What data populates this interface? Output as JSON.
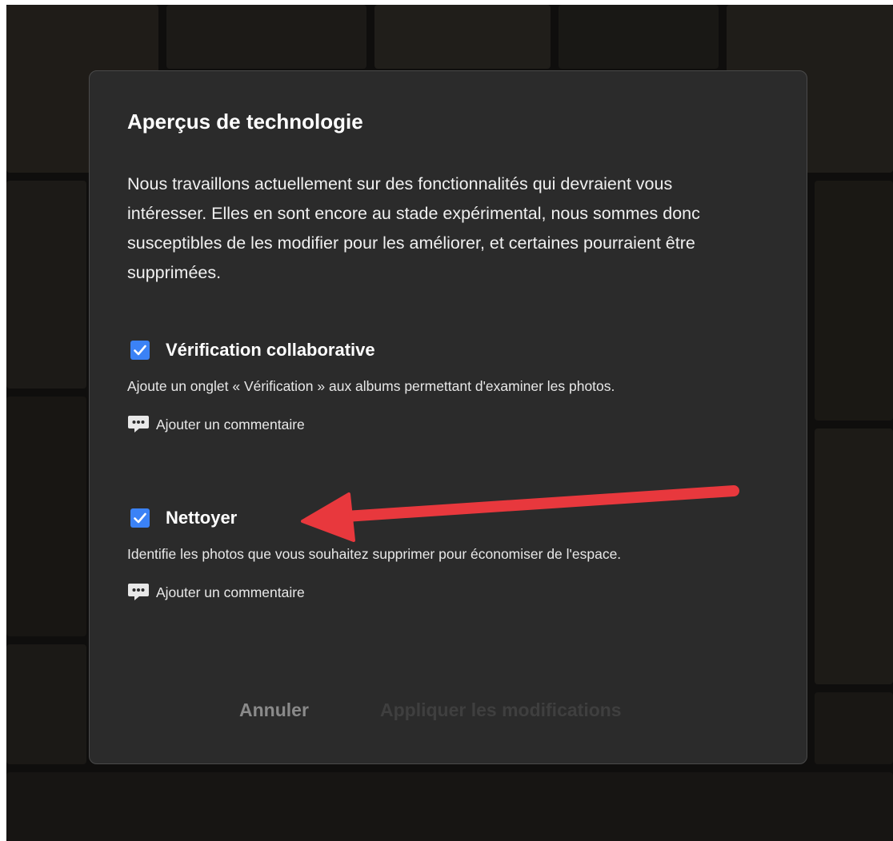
{
  "dialog": {
    "title": "Aperçus de technologie",
    "intro": "Nous travaillons actuellement sur des fonctionnalités qui devraient vous intéresser. Elles en sont encore au stade expérimental, nous sommes donc susceptibles de les modifier pour les améliorer, et certaines pourraient être supprimées.",
    "features": [
      {
        "name": "Vérification collaborative",
        "checked": true,
        "description": "Ajoute un onglet « Vérification » aux albums permettant d'examiner les photos.",
        "comment_label": "Ajouter un commentaire",
        "comment_icon": "speech-bubble-icon"
      },
      {
        "name": "Nettoyer",
        "checked": true,
        "description": "Identifie les photos que vous souhaitez supprimer pour économiser de l'espace.",
        "comment_label": "Ajouter un commentaire",
        "comment_icon": "speech-bubble-icon"
      }
    ],
    "buttons": {
      "cancel": "Annuler",
      "apply": "Appliquer les modifications",
      "apply_enabled": false
    }
  },
  "colors": {
    "checkbox": "#3b82f6",
    "dialog_bg": "#2b2b2b",
    "annotation_arrow": "#e8383d"
  },
  "annotation": {
    "type": "arrow",
    "points_to": "Nettoyer"
  }
}
